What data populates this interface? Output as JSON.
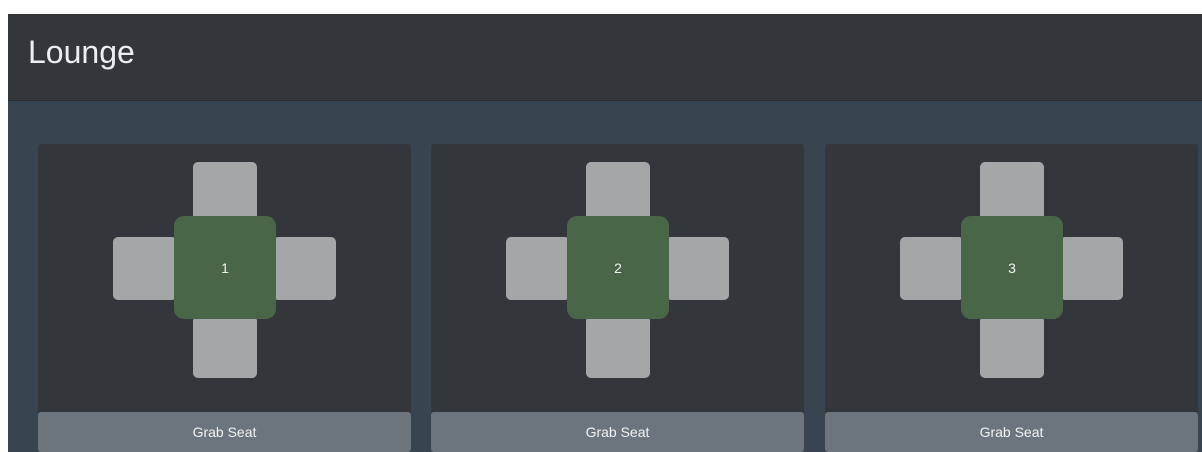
{
  "header": {
    "title": "Lounge"
  },
  "tables": [
    {
      "number": "1",
      "button_label": "Grab Seat"
    },
    {
      "number": "2",
      "button_label": "Grab Seat"
    },
    {
      "number": "3",
      "button_label": "Grab Seat"
    }
  ],
  "colors": {
    "header_bg": "#33373b",
    "page_bg": "#384450",
    "card_bg": "#33373c",
    "seat": "#a4a6a8",
    "tabletop": "#4a6648",
    "button": "#6c757d"
  }
}
